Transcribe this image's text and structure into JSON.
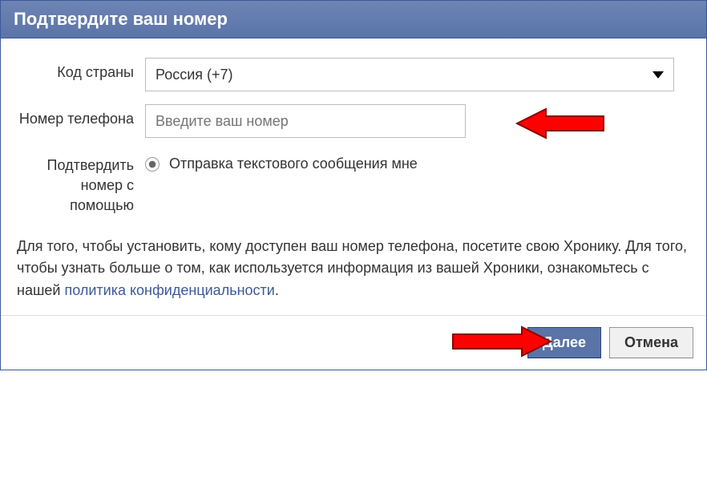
{
  "dialog": {
    "title": "Подтвердите ваш номер"
  },
  "form": {
    "country_label": "Код страны",
    "country_value": "Россия (+7)",
    "phone_label": "Номер телефона",
    "phone_placeholder": "Введите ваш номер",
    "confirm_label": "Подтвердить номер с помощью",
    "confirm_option": "Отправка текстового сообщения мне"
  },
  "info": {
    "text_pre": "Для того, чтобы установить, кому доступен ваш номер телефона, посетите свою Хронику. Для того, чтобы узнать больше о том, как используется информация из вашей Хроники, ознакомьтесь с нашей ",
    "link": "политика конфиденциальности",
    "text_post": "."
  },
  "footer": {
    "next": "Далее",
    "cancel": "Отмена"
  }
}
